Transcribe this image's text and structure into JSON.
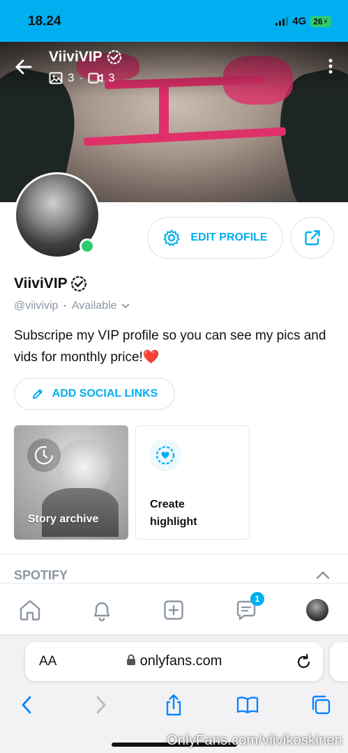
{
  "status_bar": {
    "time": "18.24",
    "network": "4G",
    "battery": "26"
  },
  "cover": {
    "name": "ViiviVIP",
    "photos_count": "3",
    "separator": "·",
    "videos_count": "3"
  },
  "profile": {
    "name": "ViiviVIP",
    "handle": "@viivivip",
    "dot": "•",
    "availability": "Available",
    "bio": "Subscripe my VIP profile so you can see my pics and vids for monthly price!❤️"
  },
  "buttons": {
    "edit_profile": "EDIT PROFILE",
    "add_social_links": "ADD SOCIAL LINKS"
  },
  "cards": {
    "story_archive": "Story archive",
    "create_highlight_line1": "Create",
    "create_highlight_line2": "highlight"
  },
  "sections": {
    "spotify": "SPOTIFY"
  },
  "bottom_nav": {
    "messages_badge": "1"
  },
  "browser": {
    "aa": "AA",
    "url": "onlyfans.com"
  },
  "watermark": "OnlyFans.com/viivikoskinen",
  "colors": {
    "accent": "#00aff0",
    "online": "#2ecc71",
    "muted": "#8a96a3"
  }
}
